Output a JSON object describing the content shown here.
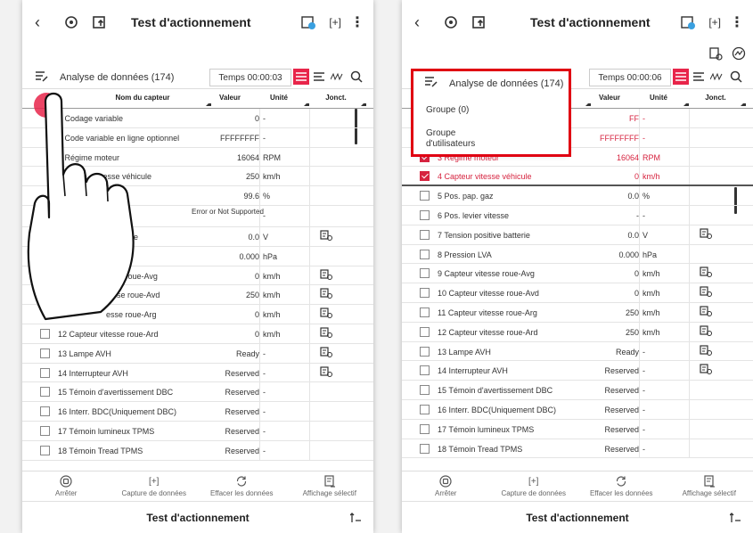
{
  "header": {
    "title": "Test d'actionnement"
  },
  "analysis": {
    "label": "Analyse de données (174)",
    "timer_left": "Temps 00:00:03",
    "timer_right": "Temps 00:00:06"
  },
  "table": {
    "col_name": "Nom du capteur",
    "col_name_partial": "du capteur",
    "col_value": "Valeur",
    "col_unit": "Unité",
    "col_junction": "Jonct."
  },
  "dropdown": {
    "item1": "Groupe (0)",
    "item2": "Groupe d'utilisateurs"
  },
  "left_rows": [
    {
      "name": "1 Codage variable",
      "value": "0",
      "unit": "-"
    },
    {
      "name": "2 Code variable en ligne optionnel",
      "value": "FFFFFFFF",
      "unit": "-"
    },
    {
      "name": "3 Régime moteur",
      "value": "16064",
      "unit": "RPM"
    },
    {
      "name": "itesse véhicule",
      "value": "250",
      "unit": "km/h"
    },
    {
      "name": "",
      "value": "99.6",
      "unit": "%"
    },
    {
      "name": "se",
      "value": "Error or Not Supported",
      "unit": "-"
    },
    {
      "name": "batterie",
      "value": "0.0",
      "unit": "V"
    },
    {
      "name": "",
      "value": "0.000",
      "unit": "hPa"
    },
    {
      "name": "esse roue-Avg",
      "value": "0",
      "unit": "km/h"
    },
    {
      "name": "tesse roue-Avd",
      "value": "250",
      "unit": "km/h"
    },
    {
      "name": "esse roue-Arg",
      "value": "0",
      "unit": "km/h"
    },
    {
      "name": "12 Capteur vitesse roue-Ard",
      "value": "0",
      "unit": "km/h"
    },
    {
      "name": "13 Lampe AVH",
      "value": "Ready",
      "unit": "-"
    },
    {
      "name": "14 Interrupteur AVH",
      "value": "Reserved",
      "unit": "-"
    },
    {
      "name": "15 Témoin d'avertissement DBC",
      "value": "Reserved",
      "unit": "-"
    },
    {
      "name": "16 Interr. BDC(Uniquement DBC)",
      "value": "Reserved",
      "unit": "-"
    },
    {
      "name": "17 Témoin lumineux TPMS",
      "value": "Reserved",
      "unit": "-"
    },
    {
      "name": "18 Témoin Tread TPMS",
      "value": "Reserved",
      "unit": "-"
    }
  ],
  "right_rows": [
    {
      "name": "",
      "value": "FF",
      "unit": "-"
    },
    {
      "name": "n ligne optionne",
      "value": "FFFFFFFF",
      "unit": "-"
    },
    {
      "name": "3 Régime moteur",
      "value": "16064",
      "unit": "RPM"
    },
    {
      "name": "4 Capteur vitesse véhicule",
      "value": "0",
      "unit": "km/h"
    },
    {
      "name": "5 Pos. pap. gaz",
      "value": "0.0",
      "unit": "%"
    },
    {
      "name": "6 Pos. levier vitesse",
      "value": "-",
      "unit": "-"
    },
    {
      "name": "7 Tension positive batterie",
      "value": "0.0",
      "unit": "V"
    },
    {
      "name": "8 Pression LVA",
      "value": "0.000",
      "unit": "hPa"
    },
    {
      "name": "9 Capteur vitesse roue-Avg",
      "value": "0",
      "unit": "km/h"
    },
    {
      "name": "10 Capteur vitesse roue-Avd",
      "value": "0",
      "unit": "km/h"
    },
    {
      "name": "11 Capteur vitesse roue-Arg",
      "value": "250",
      "unit": "km/h"
    },
    {
      "name": "12 Capteur vitesse roue-Ard",
      "value": "250",
      "unit": "km/h"
    },
    {
      "name": "13 Lampe AVH",
      "value": "Ready",
      "unit": "-"
    },
    {
      "name": "14 Interrupteur AVH",
      "value": "Reserved",
      "unit": "-"
    },
    {
      "name": "15 Témoin d'avertissement DBC",
      "value": "Reserved",
      "unit": "-"
    },
    {
      "name": "16 Interr. BDC(Uniquement DBC)",
      "value": "Reserved",
      "unit": "-"
    },
    {
      "name": "17 Témoin lumineux TPMS",
      "value": "Reserved",
      "unit": "-"
    },
    {
      "name": "18 Témoin Tread TPMS",
      "value": "Reserved",
      "unit": "-"
    }
  ],
  "bottom": {
    "stop": "Arrêter",
    "capture": "Capture de données",
    "clear": "Effacer les données",
    "selective": "Affichage sélectif"
  },
  "footer": {
    "title": "Test d'actionnement"
  },
  "colors": {
    "accent": "#e8254a",
    "highlight_box": "#e00012"
  }
}
